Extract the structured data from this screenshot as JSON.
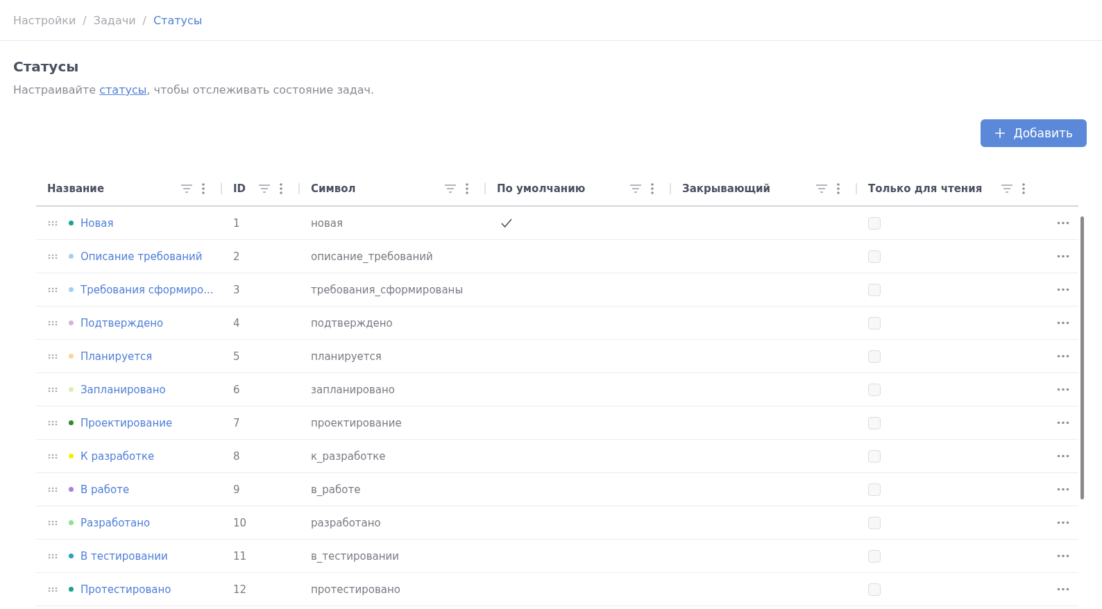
{
  "breadcrumb_separator": "/",
  "breadcrumbs": [
    {
      "label": "Настройки",
      "current": false
    },
    {
      "label": "Задачи",
      "current": false
    },
    {
      "label": "Статусы",
      "current": true
    }
  ],
  "page": {
    "title": "Статусы",
    "description": {
      "before": "Настраивайте ",
      "link": "статусы",
      "after": ", чтобы отслеживать состояние задач."
    }
  },
  "add_button": {
    "label": "Добавить"
  },
  "table": {
    "columns": [
      "Название",
      "ID",
      "Символ",
      "По умолчанию",
      "Закрывающий",
      "Только для чтения"
    ],
    "rows": [
      {
        "name": "Новая",
        "color": "#1aa39a",
        "id": "1",
        "symbol": "новая",
        "default": true,
        "read_only": false
      },
      {
        "name": "Описание требований",
        "color": "#9fd0f7",
        "id": "2",
        "symbol": "описание_требований",
        "default": false,
        "read_only": false
      },
      {
        "name": "Требования сформиро...",
        "color": "#9fd0f7",
        "id": "3",
        "symbol": "требования_сформированы",
        "default": false,
        "read_only": false
      },
      {
        "name": "Подтверждено",
        "color": "#d2b3e0",
        "id": "4",
        "symbol": "подтверждено",
        "default": false,
        "read_only": false
      },
      {
        "name": "Планируется",
        "color": "#fbd591",
        "id": "5",
        "symbol": "планируется",
        "default": false,
        "read_only": false
      },
      {
        "name": "Запланировано",
        "color": "#d6f0b0",
        "id": "6",
        "symbol": "запланировано",
        "default": false,
        "read_only": false
      },
      {
        "name": "Проектирование",
        "color": "#2e8b2e",
        "id": "7",
        "symbol": "проектирование",
        "default": false,
        "read_only": false
      },
      {
        "name": "К разработке",
        "color": "#f5f000",
        "id": "8",
        "symbol": "к_разработке",
        "default": false,
        "read_only": false
      },
      {
        "name": "В работе",
        "color": "#a983d8",
        "id": "9",
        "symbol": "в_работе",
        "default": false,
        "read_only": false
      },
      {
        "name": "Разработано",
        "color": "#8ee08e",
        "id": "10",
        "symbol": "разработано",
        "default": false,
        "read_only": false
      },
      {
        "name": "В тестировании",
        "color": "#2a9fbf",
        "id": "11",
        "symbol": "в_тестировании",
        "default": false,
        "read_only": false
      },
      {
        "name": "Протестировано",
        "color": "#1aa38a",
        "id": "12",
        "symbol": "протестировано",
        "default": false,
        "read_only": false
      }
    ]
  }
}
